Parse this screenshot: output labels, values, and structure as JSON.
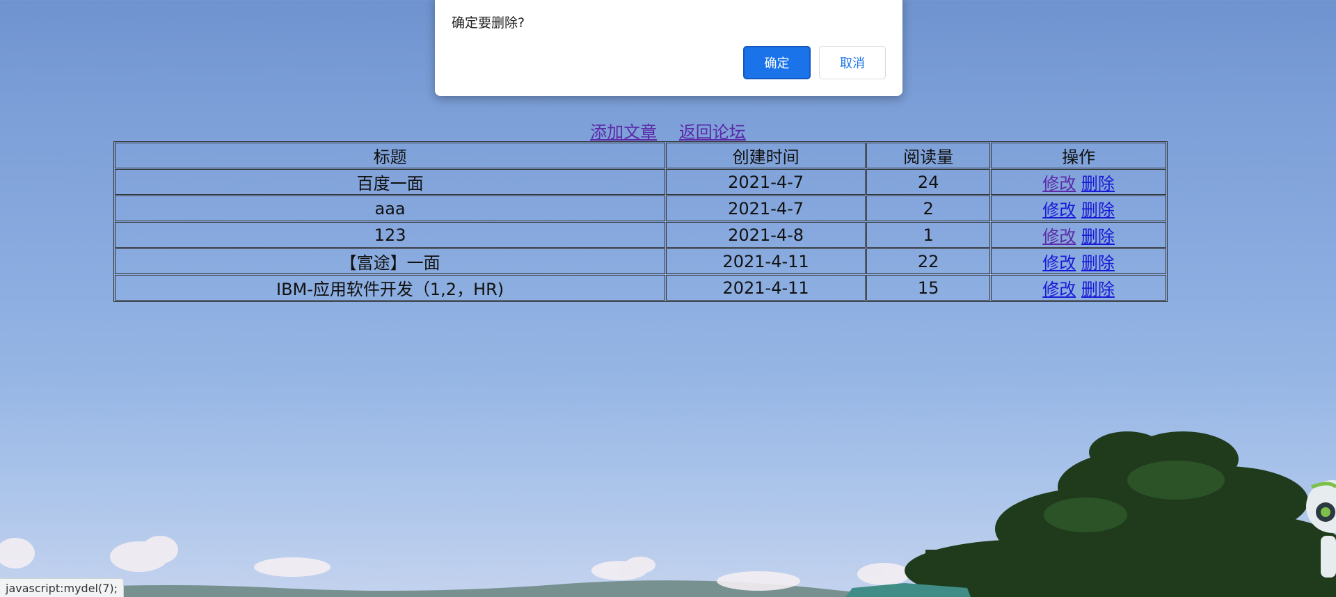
{
  "dialog": {
    "message": "确定要删除?",
    "ok_label": "确定",
    "cancel_label": "取消"
  },
  "page_links": {
    "add_article": "添加文章",
    "back_to_forum": "返回论坛"
  },
  "table": {
    "headers": [
      "标题",
      "创建时间",
      "阅读量",
      "操作"
    ],
    "rows": [
      {
        "title": "百度一面",
        "created": "2021-4-7",
        "reads": "24",
        "edit": "修改",
        "delete": "删除"
      },
      {
        "title": "aaa",
        "created": "2021-4-7",
        "reads": "2",
        "edit": "修改",
        "delete": "删除"
      },
      {
        "title": "123",
        "created": "2021-4-8",
        "reads": "1",
        "edit": "修改",
        "delete": "删除"
      },
      {
        "title": "【富途】一面",
        "created": "2021-4-11",
        "reads": "22",
        "edit": "修改",
        "delete": "删除"
      },
      {
        "title": "IBM-应用软件开发（1,2，HR)",
        "created": "2021-4-11",
        "reads": "15",
        "edit": "修改",
        "delete": "删除"
      }
    ]
  },
  "statusbar": {
    "text": "javascript:mydel(7);"
  },
  "colors": {
    "ok_button": "#1a73e8",
    "link": "#1a1ad6",
    "visited_link": "#5b2aa8"
  }
}
